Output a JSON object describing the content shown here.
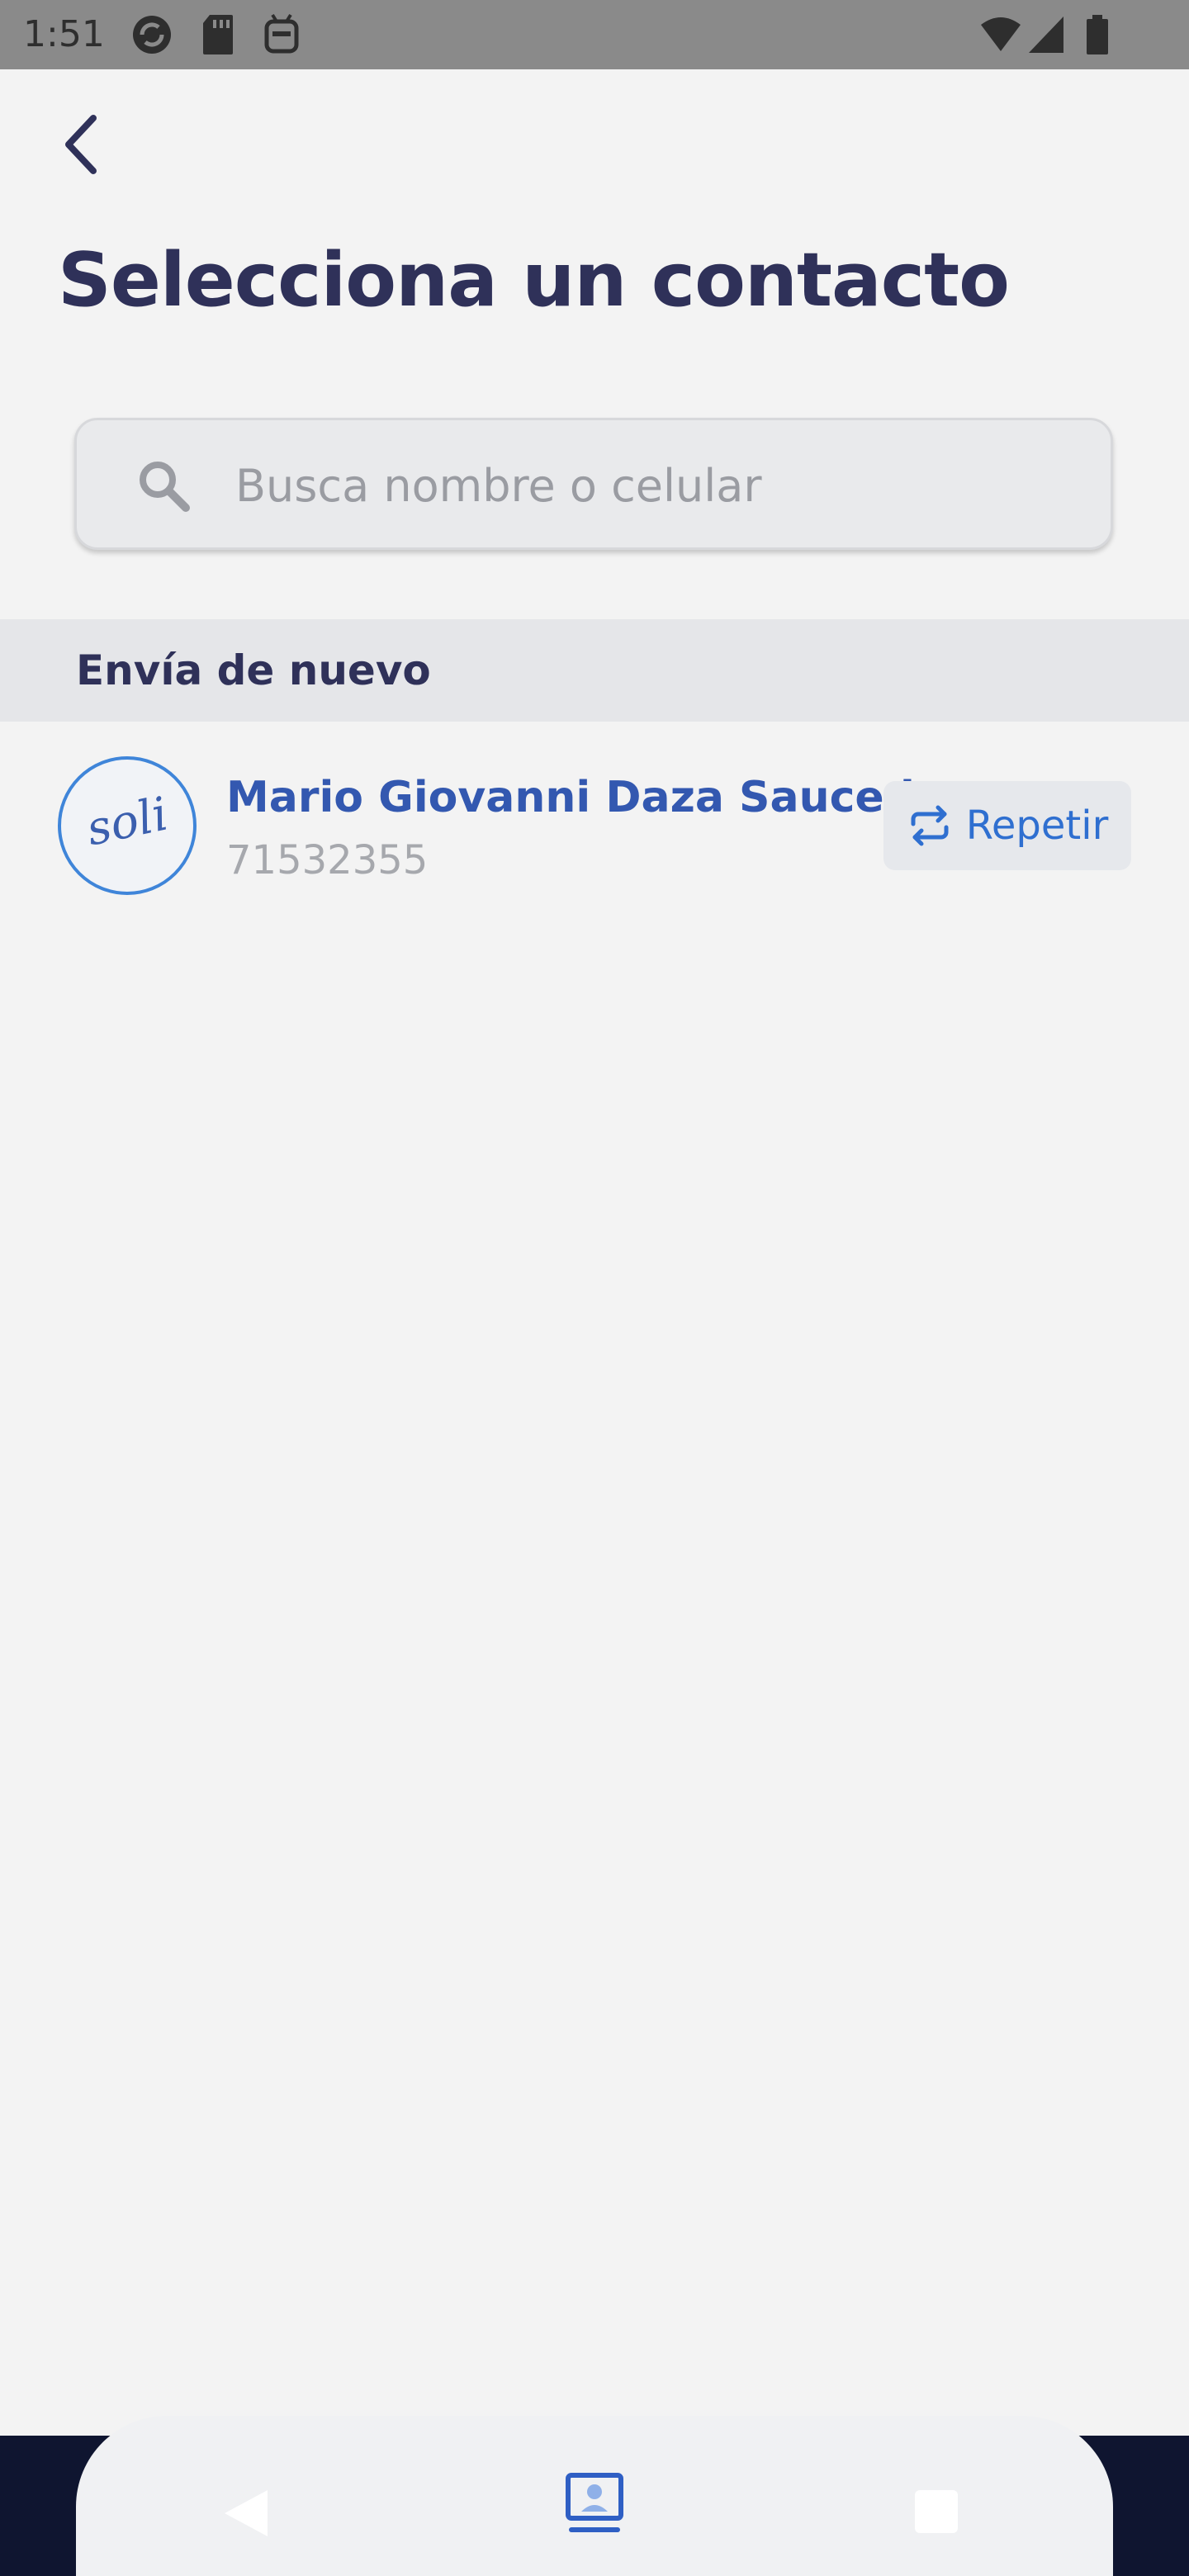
{
  "status_bar": {
    "time": "1:51",
    "left_icons": [
      "sync-icon",
      "sd-card-icon",
      "android-debug-icon"
    ],
    "right_icons": [
      "wifi-icon",
      "cell-signal-icon",
      "battery-icon"
    ]
  },
  "header": {
    "back_icon": "chevron-left-icon",
    "title": "Selecciona un contacto"
  },
  "search": {
    "icon": "search-icon",
    "placeholder": "Busca nombre o celular",
    "value": ""
  },
  "section": {
    "title": "Envía de nuevo"
  },
  "contacts": [
    {
      "avatar_text": "soli",
      "name": "Mario Giovanni Daza Saucedo",
      "phone": "71532355",
      "action_label": "Repetir",
      "action_icon": "repeat-icon"
    }
  ],
  "nav": {
    "icons": [
      "nav-back-icon",
      "nav-home-icon",
      "nav-recents-icon"
    ]
  },
  "colors": {
    "background": "#f3f3f3",
    "title": "#2f3159",
    "accent": "#3358b0",
    "action": "#2f6fd0",
    "muted": "#a6a8ad",
    "status_bar": "#8a8a8a",
    "nav_backdrop": "#0f1530"
  }
}
